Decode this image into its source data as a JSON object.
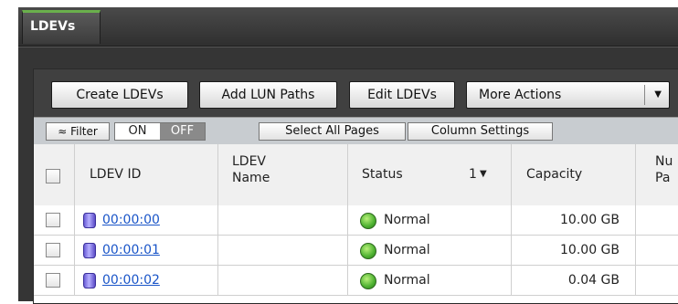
{
  "tabs": [
    {
      "label": "LDEVs"
    }
  ],
  "toolbar": {
    "create_label": "Create LDEVs",
    "add_lun_label": "Add LUN Paths",
    "edit_label": "Edit LDEVs",
    "more_label": "More Actions"
  },
  "filterbar": {
    "filter_label": "Filter",
    "on_label": "ON",
    "off_label": "OFF",
    "filter_state": "OFF",
    "select_all_label": "Select All Pages",
    "column_settings_label": "Column Settings"
  },
  "table": {
    "columns": {
      "ldev_id": "LDEV ID",
      "ldev_name_1": "LDEV",
      "ldev_name_2": "Name",
      "status": "Status",
      "sort_order": "1",
      "capacity": "Capacity",
      "partial_1": "Nu",
      "partial_2": "Pa"
    },
    "rows": [
      {
        "ldev_id": "00:00:00",
        "ldev_name": "",
        "status": "Normal",
        "capacity": "10.00 GB"
      },
      {
        "ldev_id": "00:00:01",
        "ldev_name": "",
        "status": "Normal",
        "capacity": "10.00 GB"
      },
      {
        "ldev_id": "00:00:02",
        "ldev_name": "",
        "status": "Normal",
        "capacity": "0.04 GB"
      }
    ]
  },
  "colors": {
    "tab_accent": "#6ab04c",
    "link": "#1a55c8",
    "status_ok": "#4cb030"
  },
  "icons": {
    "filter": "filter-icon",
    "sort": "sort-desc-icon",
    "ldev": "database-icon",
    "status": "status-normal-icon",
    "dropdown": "chevron-down-icon"
  }
}
